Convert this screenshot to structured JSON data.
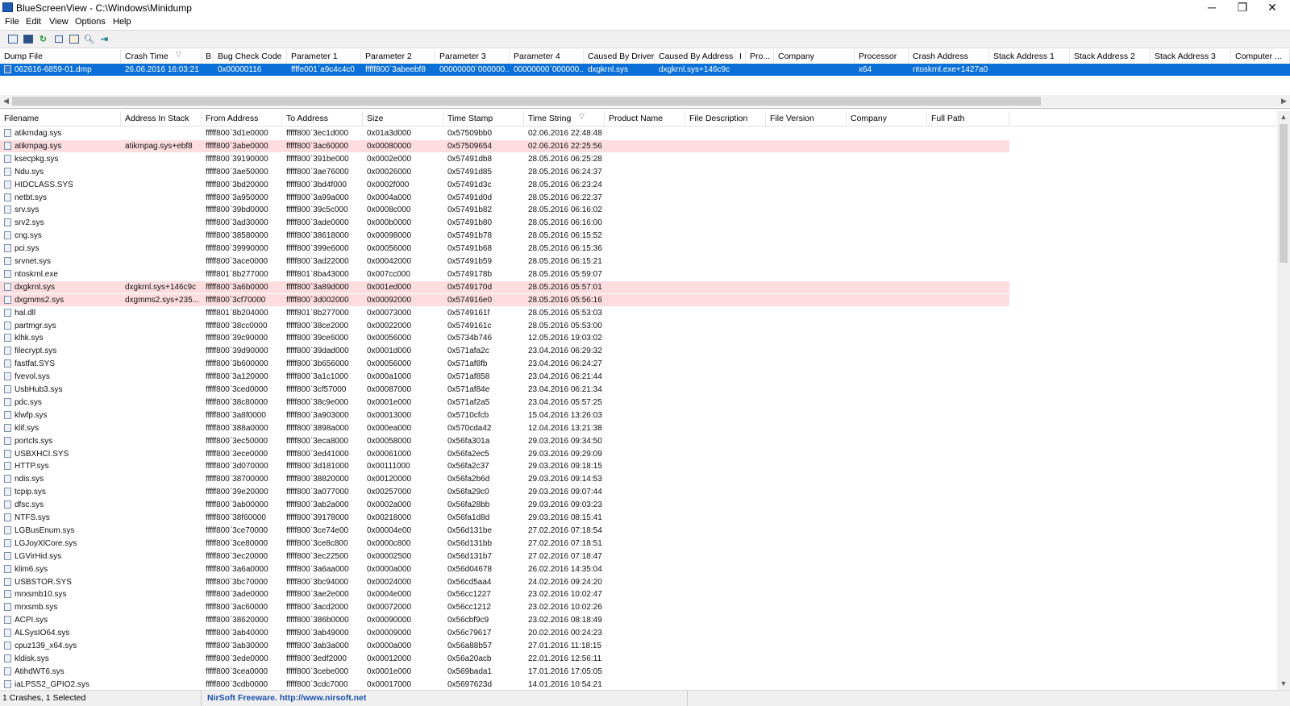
{
  "window": {
    "title": "BlueScreenView  -  C:\\Windows\\Minidump",
    "minimize": "─",
    "maximize": "❐",
    "close": "✕"
  },
  "menu": [
    "File",
    "Edit",
    "View",
    "Options",
    "Help"
  ],
  "toolbar_icons": [
    "properties-icon",
    "save-icon",
    "refresh-icon",
    "copy-icon",
    "advanced-options-icon",
    "find-icon",
    "exit-icon"
  ],
  "crash_table": {
    "columns": [
      "Dump File",
      "Crash Time",
      "B",
      "Bug Check Code",
      "Parameter 1",
      "Parameter 2",
      "Parameter 3",
      "Parameter 4",
      "Caused By Driver",
      "Caused By Address",
      "I",
      "Pro...",
      "Company",
      "Processor",
      "Crash Address",
      "Stack Address 1",
      "Stack Address 2",
      "Stack Address 3",
      "Computer ..."
    ],
    "rows": [
      [
        "062616-6859-01.dmp",
        "26.06.2016 16:03:21",
        "",
        "0x00000116",
        "ffffe001`a9c4c4c0",
        "fffff800`3abeebf8",
        "00000000`000000...",
        "00000000`000000...",
        "dxgkrnl.sys",
        "dxgkrnl.sys+146c9c",
        "",
        "",
        "",
        "x64",
        "ntoskrnl.exe+1427a0",
        "",
        "",
        "",
        ""
      ]
    ]
  },
  "driver_table": {
    "columns": [
      "Filename",
      "Address In Stack",
      "From Address",
      "To Address",
      "Size",
      "Time Stamp",
      "Time String",
      "Product Name",
      "File Description",
      "File Version",
      "Company",
      "Full Path"
    ],
    "rows": [
      [
        "atikmdag.sys",
        "",
        "fffff800`3d1e0000",
        "fffff800`3ec1d000",
        "0x01a3d000",
        "0x57509bb0",
        "02.06.2016 22:48:48"
      ],
      [
        "atikmpag.sys",
        "atikmpag.sys+ebf8",
        "fffff800`3abe0000",
        "fffff800`3ac60000",
        "0x00080000",
        "0x57509654",
        "02.06.2016 22:25:56"
      ],
      [
        "ksecpkg.sys",
        "",
        "fffff800`39190000",
        "fffff800`391be000",
        "0x0002e000",
        "0x57491db8",
        "28.05.2016 06:25:28"
      ],
      [
        "Ndu.sys",
        "",
        "fffff800`3ae50000",
        "fffff800`3ae76000",
        "0x00026000",
        "0x57491d85",
        "28.05.2016 06:24:37"
      ],
      [
        "HIDCLASS.SYS",
        "",
        "fffff800`3bd20000",
        "fffff800`3bd4f000",
        "0x0002f000",
        "0x57491d3c",
        "28.05.2016 06:23:24"
      ],
      [
        "netbt.sys",
        "",
        "fffff800`3a950000",
        "fffff800`3a99a000",
        "0x0004a000",
        "0x57491d0d",
        "28.05.2016 06:22:37"
      ],
      [
        "srv.sys",
        "",
        "fffff800`39bd0000",
        "fffff800`39c5c000",
        "0x0008c000",
        "0x57491b82",
        "28.05.2016 06:16:02"
      ],
      [
        "srv2.sys",
        "",
        "fffff800`3ad30000",
        "fffff800`3ade0000",
        "0x000b0000",
        "0x57491b80",
        "28.05.2016 06:16:00"
      ],
      [
        "cng.sys",
        "",
        "fffff800`38580000",
        "fffff800`38618000",
        "0x00098000",
        "0x57491b78",
        "28.05.2016 06:15:52"
      ],
      [
        "pci.sys",
        "",
        "fffff800`39990000",
        "fffff800`399e6000",
        "0x00056000",
        "0x57491b68",
        "28.05.2016 06:15:36"
      ],
      [
        "srvnet.sys",
        "",
        "fffff800`3ace0000",
        "fffff800`3ad22000",
        "0x00042000",
        "0x57491b59",
        "28.05.2016 06:15:21"
      ],
      [
        "ntoskrnl.exe",
        "",
        "fffff801`8b277000",
        "fffff801`8ba43000",
        "0x007cc000",
        "0x5749178b",
        "28.05.2016 05:59:07"
      ],
      [
        "dxgkrnl.sys",
        "dxgkrnl.sys+146c9c",
        "fffff800`3a6b0000",
        "fffff800`3a89d000",
        "0x001ed000",
        "0x5749170d",
        "28.05.2016 05:57:01"
      ],
      [
        "dxgmms2.sys",
        "dxgmms2.sys+235...",
        "fffff800`3cf70000",
        "fffff800`3d002000",
        "0x00092000",
        "0x574916e0",
        "28.05.2016 05:56:16"
      ],
      [
        "hal.dll",
        "",
        "fffff801`8b204000",
        "fffff801`8b277000",
        "0x00073000",
        "0x5749161f",
        "28.05.2016 05:53:03"
      ],
      [
        "partmgr.sys",
        "",
        "fffff800`38cc0000",
        "fffff800`38ce2000",
        "0x00022000",
        "0x5749161c",
        "28.05.2016 05:53:00"
      ],
      [
        "klhk.sys",
        "",
        "fffff800`39c90000",
        "fffff800`39ce6000",
        "0x00056000",
        "0x5734b746",
        "12.05.2016 19:03:02"
      ],
      [
        "filecrypt.sys",
        "",
        "fffff800`39d90000",
        "fffff800`39dad000",
        "0x0001d000",
        "0x571afa2c",
        "23.04.2016 06:29:32"
      ],
      [
        "fastfat.SYS",
        "",
        "fffff800`3b600000",
        "fffff800`3b656000",
        "0x00056000",
        "0x571af8fb",
        "23.04.2016 06:24:27"
      ],
      [
        "fvevol.sys",
        "",
        "fffff800`3a120000",
        "fffff800`3a1c1000",
        "0x000a1000",
        "0x571af858",
        "23.04.2016 06:21:44"
      ],
      [
        "UsbHub3.sys",
        "",
        "fffff800`3ced0000",
        "fffff800`3cf57000",
        "0x00087000",
        "0x571af84e",
        "23.04.2016 06:21:34"
      ],
      [
        "pdc.sys",
        "",
        "fffff800`38c80000",
        "fffff800`38c9e000",
        "0x0001e000",
        "0x571af2a5",
        "23.04.2016 05:57:25"
      ],
      [
        "klwfp.sys",
        "",
        "fffff800`3a8f0000",
        "fffff800`3a903000",
        "0x00013000",
        "0x5710cfcb",
        "15.04.2016 13:26:03"
      ],
      [
        "klif.sys",
        "",
        "fffff800`388a0000",
        "fffff800`3898a000",
        "0x000ea000",
        "0x570cda42",
        "12.04.2016 13:21:38"
      ],
      [
        "portcls.sys",
        "",
        "fffff800`3ec50000",
        "fffff800`3eca8000",
        "0x00058000",
        "0x56fa301a",
        "29.03.2016 09:34:50"
      ],
      [
        "USBXHCI.SYS",
        "",
        "fffff800`3ece0000",
        "fffff800`3ed41000",
        "0x00061000",
        "0x56fa2ec5",
        "29.03.2016 09:29:09"
      ],
      [
        "HTTP.sys",
        "",
        "fffff800`3d070000",
        "fffff800`3d181000",
        "0x00111000",
        "0x56fa2c37",
        "29.03.2016 09:18:15"
      ],
      [
        "ndis.sys",
        "",
        "fffff800`38700000",
        "fffff800`38820000",
        "0x00120000",
        "0x56fa2b6d",
        "29.03.2016 09:14:53"
      ],
      [
        "tcpip.sys",
        "",
        "fffff800`39e20000",
        "fffff800`3a077000",
        "0x00257000",
        "0x56fa29c0",
        "29.03.2016 09:07:44"
      ],
      [
        "dfsc.sys",
        "",
        "fffff800`3ab00000",
        "fffff800`3ab2a000",
        "0x0002a000",
        "0x56fa28bb",
        "29.03.2016 09:03:23"
      ],
      [
        "NTFS.sys",
        "",
        "fffff800`38f60000",
        "fffff800`39178000",
        "0x00218000",
        "0x56fa1d8d",
        "29.03.2016 08:15:41"
      ],
      [
        "LGBusEnum.sys",
        "",
        "fffff800`3ce70000",
        "fffff800`3ce74e00",
        "0x00004e00",
        "0x56d131be",
        "27.02.2016 07:18:54"
      ],
      [
        "LGJoyXlCore.sys",
        "",
        "fffff800`3ce80000",
        "fffff800`3ce8c800",
        "0x0000c800",
        "0x56d131bb",
        "27.02.2016 07:18:51"
      ],
      [
        "LGVirHid.sys",
        "",
        "fffff800`3ec20000",
        "fffff800`3ec22500",
        "0x00002500",
        "0x56d131b7",
        "27.02.2016 07:18:47"
      ],
      [
        "klim6.sys",
        "",
        "fffff800`3a6a0000",
        "fffff800`3a6aa000",
        "0x0000a000",
        "0x56d04678",
        "26.02.2016 14:35:04"
      ],
      [
        "USBSTOR.SYS",
        "",
        "fffff800`3bc70000",
        "fffff800`3bc94000",
        "0x00024000",
        "0x56cd5aa4",
        "24.02.2016 09:24:20"
      ],
      [
        "mrxsmb10.sys",
        "",
        "fffff800`3ade0000",
        "fffff800`3ae2e000",
        "0x0004e000",
        "0x56cc1227",
        "23.02.2016 10:02:47"
      ],
      [
        "mrxsmb.sys",
        "",
        "fffff800`3ac60000",
        "fffff800`3acd2000",
        "0x00072000",
        "0x56cc1212",
        "23.02.2016 10:02:26"
      ],
      [
        "ACPI.sys",
        "",
        "fffff800`38620000",
        "fffff800`386b0000",
        "0x00090000",
        "0x56cbf9c9",
        "23.02.2016 08:18:49"
      ],
      [
        "ALSysIO64.sys",
        "",
        "fffff800`3ab40000",
        "fffff800`3ab49000",
        "0x00009000",
        "0x56c79617",
        "20.02.2016 00:24:23"
      ],
      [
        "cpuz139_x64.sys",
        "",
        "fffff800`3ab30000",
        "fffff800`3ab3a000",
        "0x0000a000",
        "0x56a88b57",
        "27.01.2016 11:18:15"
      ],
      [
        "kldisk.sys",
        "",
        "fffff800`3ede0000",
        "fffff800`3edf2000",
        "0x00012000",
        "0x56a20acb",
        "22.01.2016 12:56:11"
      ],
      [
        "AtihdWT6.sys",
        "",
        "fffff800`3cea0000",
        "fffff800`3cebe000",
        "0x0001e000",
        "0x569bada1",
        "17.01.2016 17:05:05"
      ],
      [
        "iaLPSS2_GPIO2.sys",
        "",
        "fffff800`3cdb0000",
        "fffff800`3cdc7000",
        "0x00017000",
        "0x5697623d",
        "14.01.2016 10:54:21"
      ]
    ],
    "highlighted_rows": [
      "atikmpag.sys",
      "dxgkrnl.sys",
      "dxgmms2.sys"
    ]
  },
  "status": {
    "summary": "1 Crashes, 1 Selected",
    "credit": "NirSoft Freeware.  http://www.nirsoft.net"
  },
  "colors": {
    "selection": "#0a6fd6",
    "highlight": "#fddde0",
    "link": "#1d4fb0"
  }
}
